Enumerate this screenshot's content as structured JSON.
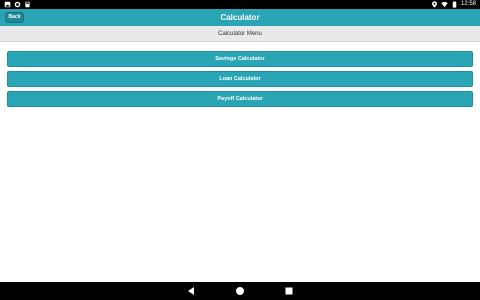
{
  "status_bar": {
    "time": "12:58",
    "left_icons": [
      "photo-icon",
      "sync-icon",
      "storage-icon"
    ],
    "right_icons": [
      "location-icon",
      "wifi-icon",
      "battery-icon"
    ]
  },
  "header": {
    "back_label": "Back",
    "title": "Calculator",
    "background_color": "#2aa5b6"
  },
  "sub_header": {
    "title": "Calculator Menu"
  },
  "menu": {
    "items": [
      {
        "label": "Savings Calculator"
      },
      {
        "label": "Loan Calculator"
      },
      {
        "label": "Payoff Calculator"
      }
    ]
  },
  "nav_bar": {
    "icons": [
      "back-triangle-icon",
      "home-circle-icon",
      "recents-square-icon"
    ]
  }
}
